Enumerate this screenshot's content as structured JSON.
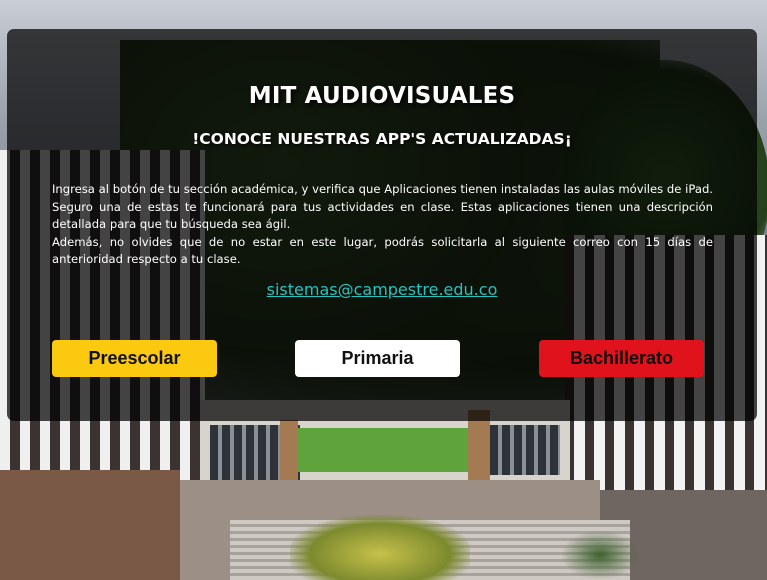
{
  "header": {
    "title": "MIT AUDIOVISUALES",
    "subtitle": "!CONOCE NUESTRAS APP'S ACTUALIZADAS¡"
  },
  "description": {
    "paragraph1": "Ingresa al botón de tu sección académica, y verifica que Aplicaciones tienen instaladas las aulas móviles de iPad. Seguro una de estas te funcionará para tus actividades en clase. Estas aplicaciones tienen una descripción detallada para que tu búsqueda sea ágil.",
    "paragraph2": "Además, no olvides que de no estar en este lugar, podrás solicitarla al siguiente correo con 15 días de anterioridad respecto a tu clase."
  },
  "contact": {
    "email": "sistemas@campestre.edu.co"
  },
  "sections": {
    "preescolar": {
      "label": "Preescolar",
      "color": "#fbc90f"
    },
    "primaria": {
      "label": "Primaria",
      "color": "#ffffff"
    },
    "bachillerato": {
      "label": "Bachillerato",
      "color": "#e0121b"
    }
  },
  "colors": {
    "link": "#27c3c0",
    "panel_overlay": "rgba(0,0,0,0.72)"
  }
}
